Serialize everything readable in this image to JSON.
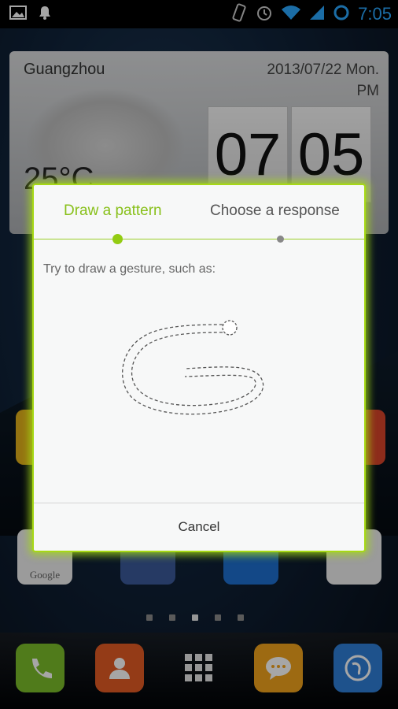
{
  "status_bar": {
    "time": "7:05",
    "icons": [
      "image-icon",
      "notification-icon",
      "vibrate-icon",
      "alarm-icon",
      "wifi-icon",
      "signal-icon",
      "battery-icon"
    ]
  },
  "widget": {
    "city": "Guangzhou",
    "date_line1": "2013/07/22 Mon.",
    "date_line2": "PM",
    "hour": "07",
    "minute": "05",
    "temperature": "25°C"
  },
  "dialog": {
    "tab_active": "Draw a pattern",
    "tab_next": "Choose a response",
    "instruction": "Try to draw a gesture, such as:",
    "cancel_label": "Cancel"
  },
  "colors": {
    "accent": "#a7d916",
    "accent_text": "#88c01a",
    "status_time": "#2aa8ff"
  },
  "home": {
    "google_label": "Google",
    "pager_count": 5,
    "pager_active_index": 2
  },
  "dock": [
    "phone-icon",
    "contacts-icon",
    "app-drawer-icon",
    "messaging-icon",
    "browser-icon"
  ]
}
